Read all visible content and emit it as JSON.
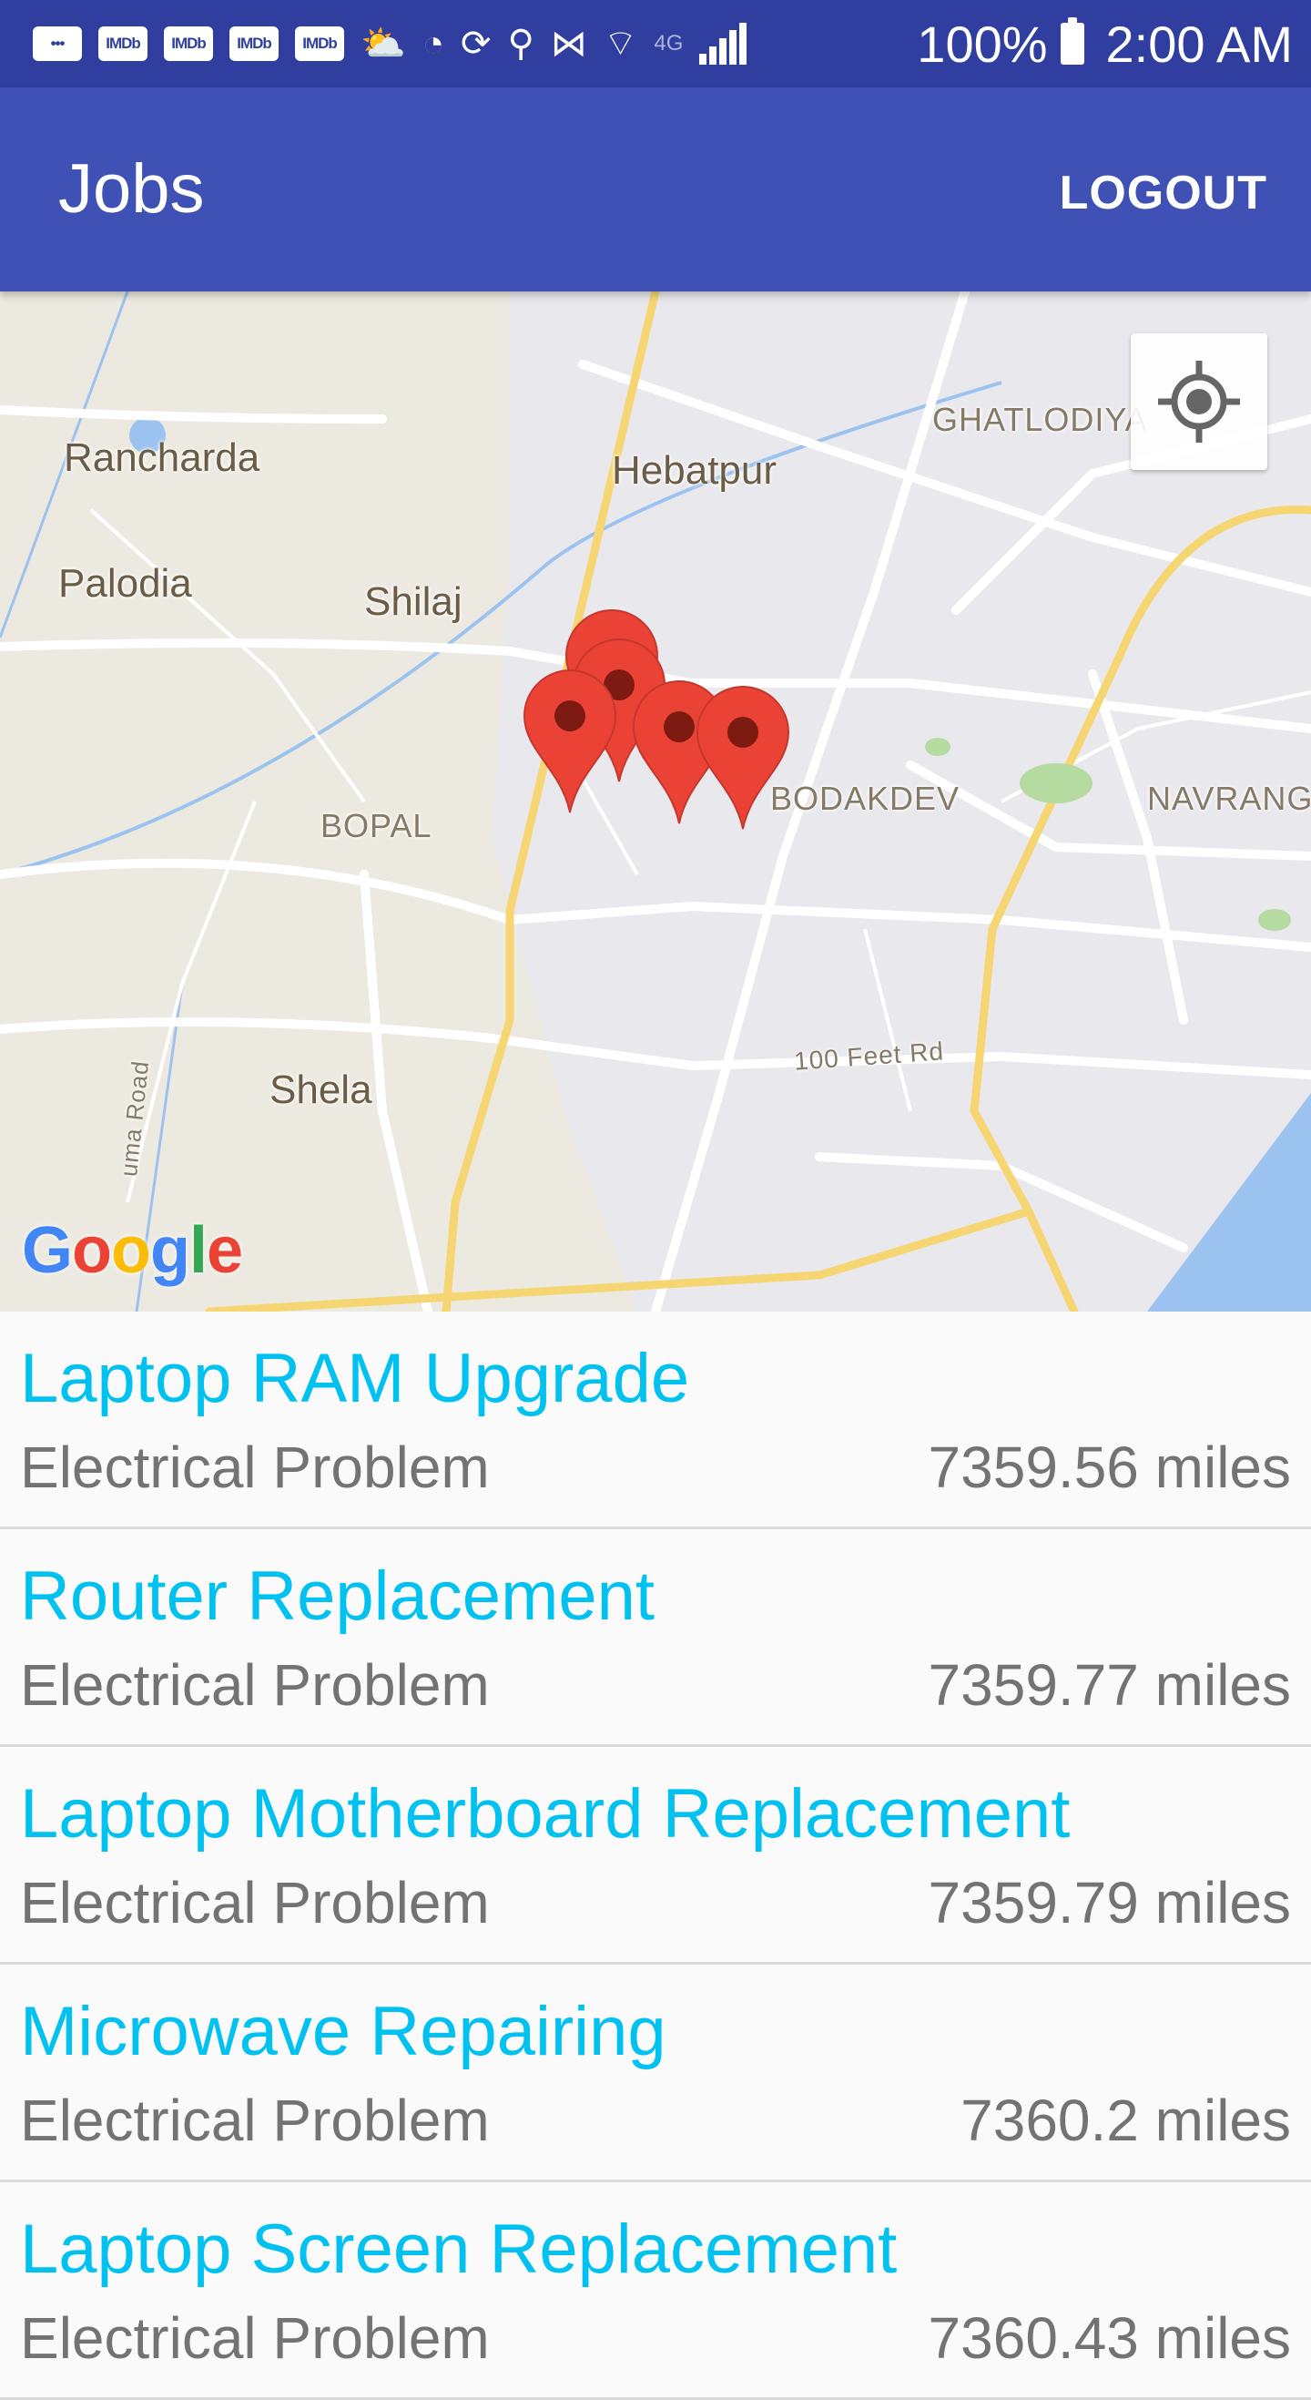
{
  "status_bar": {
    "notification_icons": [
      "chat-icon",
      "IMDb",
      "IMDb",
      "IMDb",
      "IMDb",
      "weather-icon",
      "vodafone-icon",
      "screen-rotate-icon",
      "location-icon",
      "vibrate-icon",
      "wifi-icon",
      "4g-icon",
      "signal-icon"
    ],
    "imdb_label": "IMDb",
    "battery": "100%",
    "time": "2:00 AM"
  },
  "app_bar": {
    "title": "Jobs",
    "logout_label": "LOGOUT"
  },
  "map": {
    "labels": {
      "ranchardа": "Rancharda",
      "hebatpur": "Hebatpur",
      "ghatlodiya": "GHATLODIYA",
      "palodia": "Palodia",
      "shilaj": "Shilaj",
      "bopal": "BOPAL",
      "bodakdev": "BODAKDEV",
      "navrangpura": "NAVRANGP",
      "shela": "Shela",
      "feet_rd": "100 Feet Rd",
      "uma_road": "uma Road"
    },
    "attribution": "Google",
    "pin_color": "#ea4335",
    "pin_count": 5
  },
  "jobs": [
    {
      "title": "Laptop RAM Upgrade",
      "category": "Electrical Problem",
      "distance": "7359.56 miles"
    },
    {
      "title": "Router Replacement",
      "category": "Electrical Problem",
      "distance": "7359.77 miles"
    },
    {
      "title": "Laptop Motherboard Replacement",
      "category": "Electrical Problem",
      "distance": "7359.79 miles"
    },
    {
      "title": "Microwave Repairing",
      "category": "Electrical Problem",
      "distance": "7360.2 miles"
    },
    {
      "title": "Laptop Screen Replacement",
      "category": "Electrical Problem",
      "distance": "7360.43 miles"
    }
  ],
  "colors": {
    "status_bar": "#303f9f",
    "app_bar": "#3f51b5",
    "job_title": "#00c1f0",
    "secondary_text": "#737373"
  }
}
